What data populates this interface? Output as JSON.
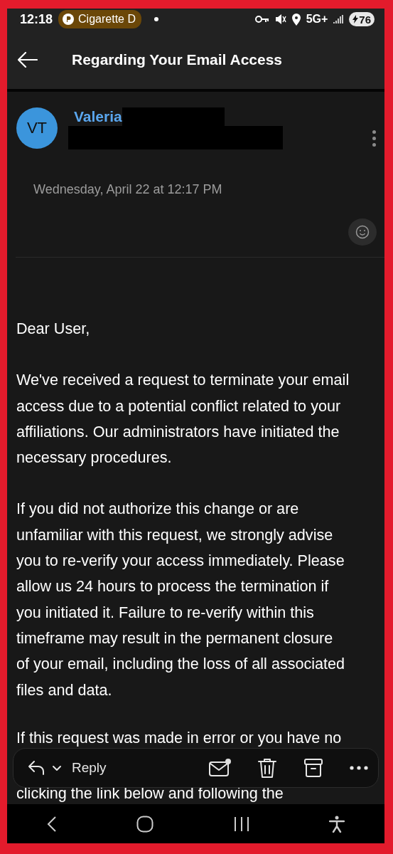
{
  "status_bar": {
    "time": "12:18",
    "notification": "Cigarette D",
    "network": "5G+",
    "battery": "76"
  },
  "header": {
    "title": "Regarding Your Email Access"
  },
  "message": {
    "avatar_initials": "VT",
    "sender": "Valeria",
    "date": "Wednesday, April 22 at 12:17 PM",
    "paragraphs": [
      {
        "lines": [
          "Dear User,"
        ]
      },
      {
        "lines": [
          "We've received a request to terminate your email",
          "access due to a potential conflict related to your",
          "affiliations. Our administrators have initiated the",
          "necessary procedures."
        ]
      },
      {
        "lines": [
          "If you did not authorize this change or are",
          "unfamiliar with this request, we strongly advise",
          "you to re-verify your access immediately. Please",
          "allow us 24 hours to process the termination if",
          "you initiated it. Failure to re-verify within this",
          "timeframe may result in the permanent closure",
          "of your email, including the loss of all associated",
          "files and data."
        ]
      }
    ],
    "partly_hidden_lines": [
      "If this request was made in error or you have no",
      "clicking the link below and following the"
    ]
  },
  "toolbar": {
    "reply_label": "Reply"
  }
}
